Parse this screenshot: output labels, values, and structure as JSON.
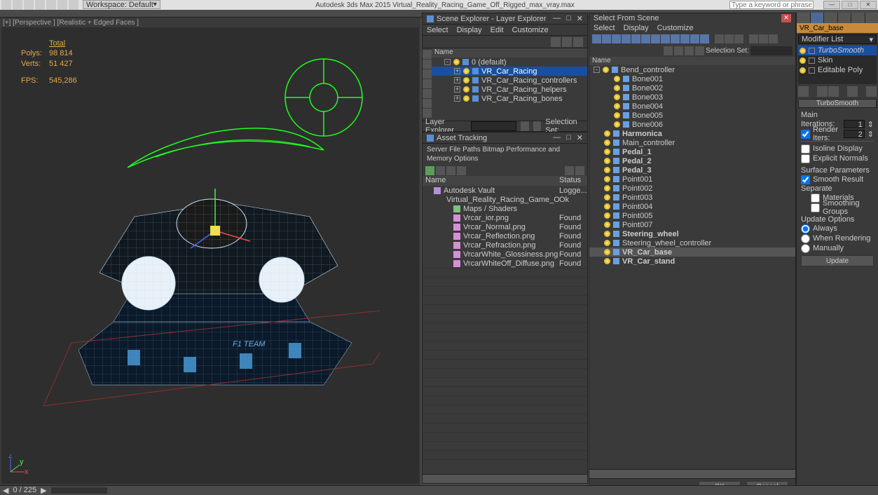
{
  "titlebar": {
    "workspace_label": "Workspace: Default",
    "title": "Autodesk 3ds Max  2015    Virtual_Reality_Racing_Game_Off_Rigged_max_vray.max",
    "search_placeholder": "Type a keyword or phrase"
  },
  "viewport": {
    "label": "[+] [Perspective ] [Realistic + Edged Faces ]",
    "stats_header": "Total",
    "polys_label": "Polys:",
    "polys": "98 814",
    "verts_label": "Verts:",
    "verts": "51 427",
    "fps_label": "FPS:",
    "fps": "545,286"
  },
  "scene_explorer": {
    "title": "Scene Explorer - Layer Explorer",
    "menu": [
      "Select",
      "Display",
      "Edit",
      "Customize"
    ],
    "tree_header": "Name",
    "items": [
      {
        "label": "0 (default)",
        "indent": 1,
        "expand": "-"
      },
      {
        "label": "VR_Car_Racing",
        "indent": 2,
        "selected": true,
        "expand": "+"
      },
      {
        "label": "VR_Car_Racing_controllers",
        "indent": 2,
        "expand": "+"
      },
      {
        "label": "VR_Car_Racing_helpers",
        "indent": 2,
        "expand": "+"
      },
      {
        "label": "VR_Car_Racing_bones",
        "indent": 2,
        "expand": "+"
      }
    ],
    "layer_label": "Layer Explorer",
    "selection_set": "Selection Set:"
  },
  "asset_tracking": {
    "title": "Asset Tracking",
    "menu": "Server   File   Paths   Bitmap Performance and Memory Options",
    "col_name": "Name",
    "col_status": "Status",
    "rows": [
      {
        "label": "Autodesk Vault",
        "indent": 1,
        "icon": "db",
        "status": "Logge..."
      },
      {
        "label": "Virtual_Reality_Racing_Game_Off_Rigged_max_v...",
        "indent": 2,
        "icon": "db",
        "status": "Ok"
      },
      {
        "label": "Maps / Shaders",
        "indent": 3,
        "icon": "map",
        "status": ""
      },
      {
        "label": "Vrcar_ior.png",
        "indent": 3,
        "icon": "img",
        "status": "Found"
      },
      {
        "label": "Vrcar_Normal.png",
        "indent": 3,
        "icon": "img",
        "status": "Found"
      },
      {
        "label": "Vrcar_Reflection.png",
        "indent": 3,
        "icon": "img",
        "status": "Found"
      },
      {
        "label": "Vrcar_Refraction.png",
        "indent": 3,
        "icon": "img",
        "status": "Found"
      },
      {
        "label": "VrcarWhite_Glossiness.png",
        "indent": 3,
        "icon": "img",
        "status": "Found"
      },
      {
        "label": "VrcarWhiteOff_Diffuse.png",
        "indent": 3,
        "icon": "img",
        "status": "Found"
      }
    ]
  },
  "select_scene": {
    "title": "Select From Scene",
    "menu": [
      "Select",
      "Display",
      "Customize"
    ],
    "selection_set": "Selection Set:",
    "header": "Name",
    "rows": [
      {
        "label": "Bend_controller",
        "indent": 0,
        "expand": "-"
      },
      {
        "label": "Bone001",
        "indent": 1
      },
      {
        "label": "Bone002",
        "indent": 1
      },
      {
        "label": "Bone003",
        "indent": 1
      },
      {
        "label": "Bone004",
        "indent": 1
      },
      {
        "label": "Bone005",
        "indent": 1
      },
      {
        "label": "Bone006",
        "indent": 1
      },
      {
        "label": "Harmonica",
        "indent": 0,
        "bold": true
      },
      {
        "label": "Main_controller",
        "indent": 0
      },
      {
        "label": "Pedal_1",
        "indent": 0,
        "bold": true
      },
      {
        "label": "Pedal_2",
        "indent": 0,
        "bold": true
      },
      {
        "label": "Pedal_3",
        "indent": 0,
        "bold": true
      },
      {
        "label": "Point001",
        "indent": 0
      },
      {
        "label": "Point002",
        "indent": 0
      },
      {
        "label": "Point003",
        "indent": 0
      },
      {
        "label": "Point004",
        "indent": 0
      },
      {
        "label": "Point005",
        "indent": 0
      },
      {
        "label": "Point007",
        "indent": 0
      },
      {
        "label": "Steering_wheel",
        "indent": 0,
        "bold": true
      },
      {
        "label": "Steering_wheel_controller",
        "indent": 0
      },
      {
        "label": "VR_Car_base",
        "indent": 0,
        "bold": true,
        "selected": true
      },
      {
        "label": "VR_Car_stand",
        "indent": 0,
        "bold": true
      }
    ],
    "ok": "OK",
    "cancel": "Cancel"
  },
  "command_panel": {
    "object_name": "VR_Car_base",
    "modifier_list": "Modifier List",
    "stack": [
      {
        "label": "TurboSmooth",
        "italic": true,
        "selected": true
      },
      {
        "label": "Skin"
      },
      {
        "label": "Editable Poly"
      }
    ],
    "rollout_title": "TurboSmooth",
    "main_label": "Main",
    "iterations_label": "Iterations:",
    "iterations": "1",
    "render_iters_label": "Render Iters:",
    "render_iters": "2",
    "isoline": "Isoline Display",
    "explicit": "Explicit Normals",
    "surf_params": "Surface Parameters",
    "smooth_result": "Smooth Result",
    "separate": "Separate",
    "materials": "Materials",
    "smoothing_groups": "Smoothing Groups",
    "update_options": "Update Options",
    "always": "Always",
    "when_rendering": "When Rendering",
    "manually": "Manually",
    "update_btn": "Update"
  },
  "status": {
    "frame": "0 / 225"
  }
}
